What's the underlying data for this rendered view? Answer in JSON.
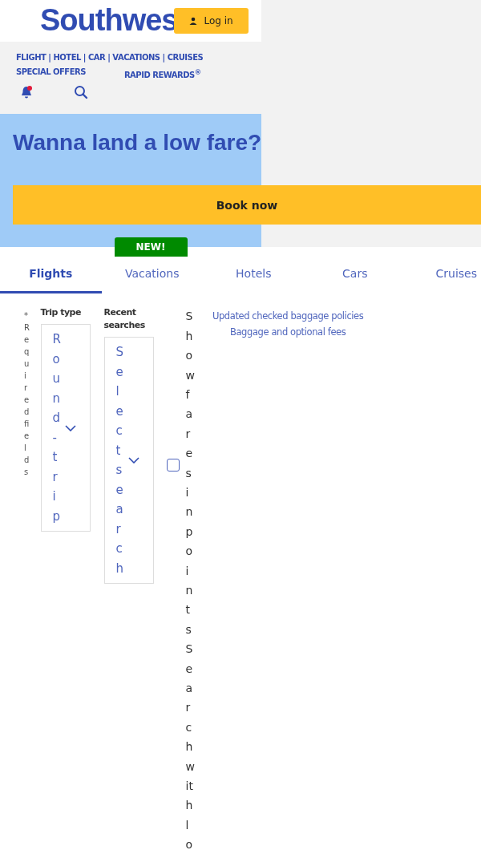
{
  "header": {
    "logo": "Southwes",
    "login": "Log in"
  },
  "nav": {
    "links": [
      "FLIGHT | HOTEL | CAR | VACATIONS | CRUISES"
    ],
    "special": "SPECIAL OFFERS",
    "rewards": "RAPID REWARDS$^{®}$",
    "notification": true
  },
  "hero": {
    "title": "Wanna land a low fare?",
    "button": "Book now"
  },
  "tabs": [
    {
      "label": "Flights",
      "selected": true
    },
    {
      "label": "Vacations",
      "selected": false,
      "badge": "NEW!"
    },
    {
      "label": "Hotels",
      "selected": false
    },
    {
      "label": "Cars",
      "selected": false
    },
    {
      "label": "Cruises",
      "selected": false
    }
  ],
  "form": {
    "required_note": "* Required fields",
    "trip_type": {
      "label": "Trip type",
      "value": "Round-trip"
    },
    "recent": {
      "label": "Recent searches",
      "placeholder": "Select search"
    },
    "points": {
      "checked": false,
      "label": "Show fares in points",
      "next": "Search with lo"
    },
    "links": [
      "Updated checked baggage policies",
      "Baggage and optional fees"
    ]
  }
}
